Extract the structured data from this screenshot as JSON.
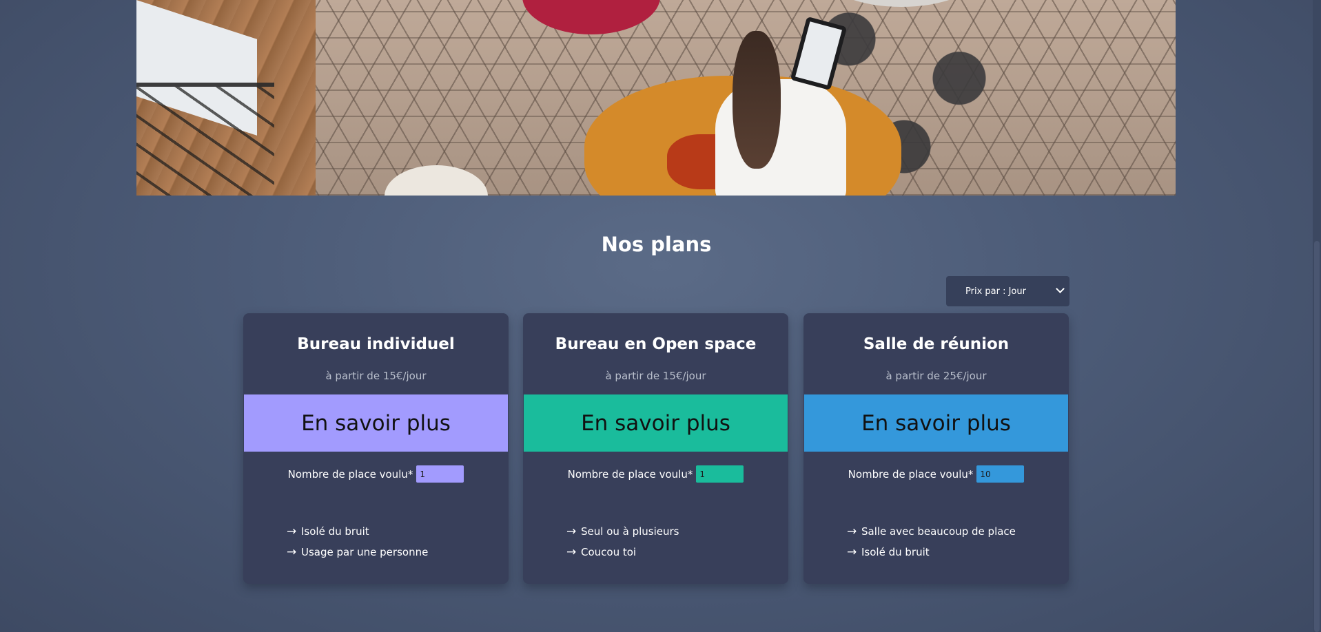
{
  "hero": {
    "image_alt": "coworking-photo"
  },
  "plans_section": {
    "title": "Nos plans",
    "period_select": {
      "selected": "Prix par : Jour"
    },
    "plans": [
      {
        "title": "Bureau individuel",
        "price": "à partir de 15€/jour",
        "cta": "En savoir plus",
        "seats_label": "Nombre de place voulu*",
        "seats_value": "1",
        "accent": "#a29bfe",
        "features": [
          "Isolé du bruit",
          "Usage par une personne"
        ]
      },
      {
        "title": "Bureau en Open space",
        "price": "à partir de 15€/jour",
        "cta": "En savoir plus",
        "seats_label": "Nombre de place voulu*",
        "seats_value": "1",
        "accent": "#1abc9c",
        "features": [
          "Seul ou à plusieurs",
          "Coucou toi"
        ]
      },
      {
        "title": "Salle de réunion",
        "price": "à partir de 25€/jour",
        "cta": "En savoir plus",
        "seats_label": "Nombre de place voulu*",
        "seats_value": "10",
        "accent": "#3498db",
        "features": [
          "Salle avec beaucoup de place",
          "Isolé du bruit"
        ]
      }
    ]
  },
  "icons": {
    "feature_bullet": "arrow-right-icon",
    "select_caret": "chevron-down-icon"
  }
}
